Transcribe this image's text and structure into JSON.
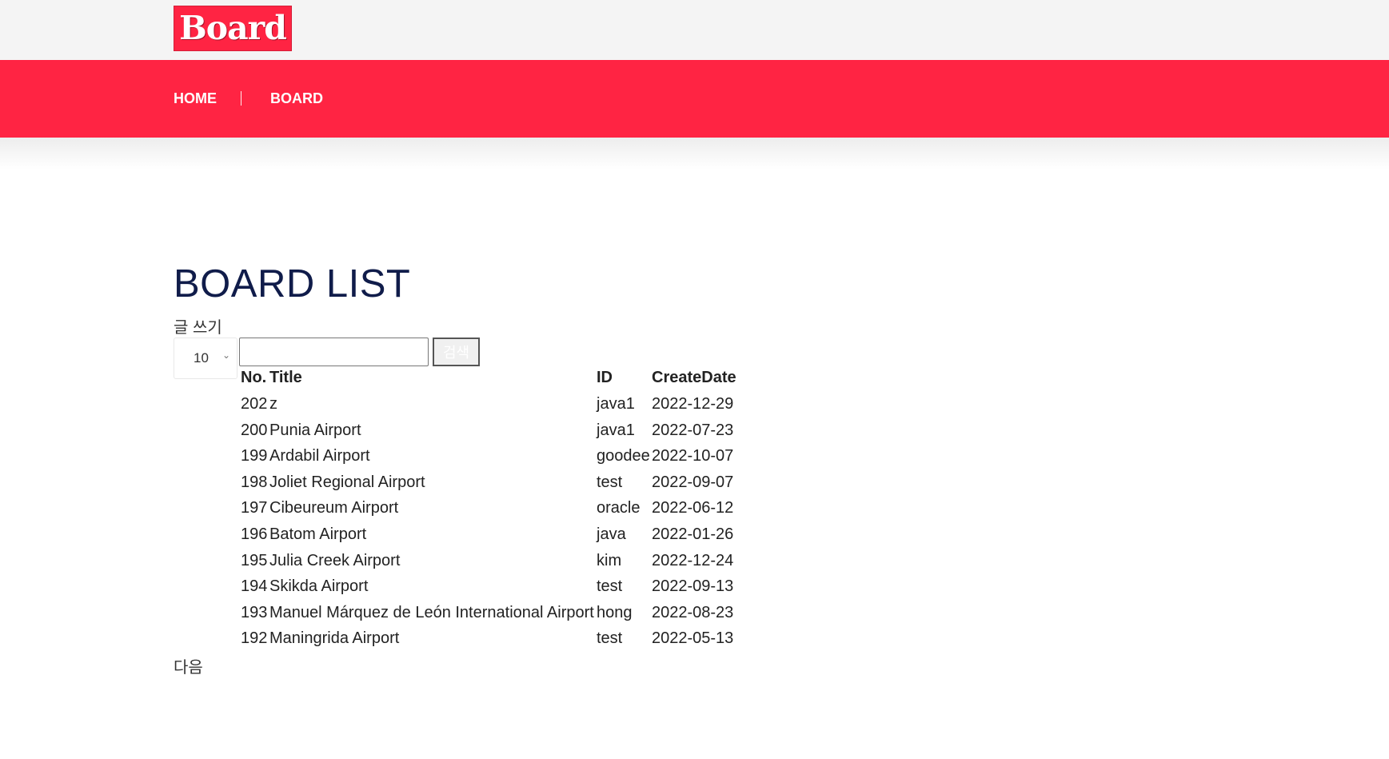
{
  "header": {
    "logo_text": "Board",
    "nav": [
      {
        "label": "HOME"
      },
      {
        "label": "BOARD"
      }
    ],
    "colors": {
      "accent": "#ff2443",
      "topbar": "#f4f4f4",
      "title": "#101c4a"
    }
  },
  "main": {
    "title": "BOARD LIST",
    "write_link": "글 쓰기",
    "rows_per_page": "10",
    "search": {
      "value": "",
      "placeholder": "",
      "button_label": "검색"
    },
    "table": {
      "columns": {
        "no": "No.",
        "title": "Title",
        "id": "ID",
        "date": "CreateDate"
      },
      "rows": [
        {
          "no": "202",
          "title": "z",
          "id": "java1",
          "date": "2022-12-29"
        },
        {
          "no": "200",
          "title": "Punia Airport",
          "id": "java1",
          "date": "2022-07-23"
        },
        {
          "no": "199",
          "title": "Ardabil Airport",
          "id": "goodee",
          "date": "2022-10-07"
        },
        {
          "no": "198",
          "title": "Joliet Regional Airport",
          "id": "test",
          "date": "2022-09-07"
        },
        {
          "no": "197",
          "title": "Cibeureum Airport",
          "id": "oracle",
          "date": "2022-06-12"
        },
        {
          "no": "196",
          "title": "Batom Airport",
          "id": "java",
          "date": "2022-01-26"
        },
        {
          "no": "195",
          "title": "Julia Creek Airport",
          "id": "kim",
          "date": "2022-12-24"
        },
        {
          "no": "194",
          "title": "Skikda Airport",
          "id": "test",
          "date": "2022-09-13"
        },
        {
          "no": "193",
          "title": "Manuel Márquez de León International Airport",
          "id": "hong",
          "date": "2022-08-23"
        },
        {
          "no": "192",
          "title": "Maningrida Airport",
          "id": "test",
          "date": "2022-05-13"
        }
      ]
    },
    "next_link": "다음"
  },
  "icons": {
    "select_chevron": "chevron-down-icon"
  }
}
